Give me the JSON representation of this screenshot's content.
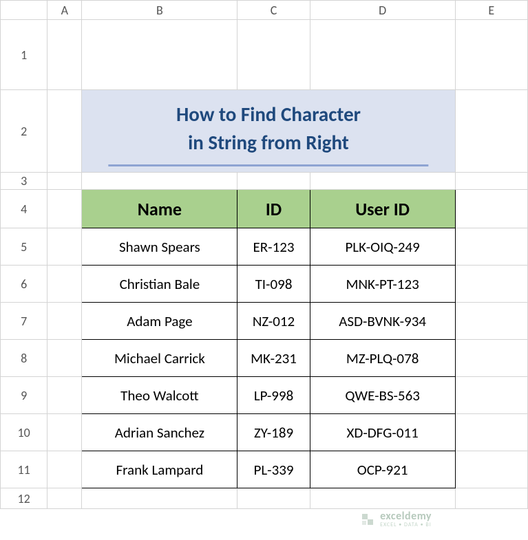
{
  "columns": [
    "A",
    "B",
    "C",
    "D",
    "E"
  ],
  "rows": [
    "1",
    "2",
    "3",
    "4",
    "5",
    "6",
    "7",
    "8",
    "9",
    "10",
    "11",
    "12"
  ],
  "title": {
    "line1": "How to Find Character",
    "line2": "in String from Right"
  },
  "table": {
    "headers": {
      "name": "Name",
      "id": "ID",
      "user_id": "User ID"
    },
    "rows": [
      {
        "name": "Shawn Spears",
        "id": "ER-123",
        "user_id": "PLK-OIQ-249"
      },
      {
        "name": "Christian Bale",
        "id": "TI-098",
        "user_id": "MNK-PT-123"
      },
      {
        "name": "Adam Page",
        "id": "NZ-012",
        "user_id": "ASD-BVNK-934"
      },
      {
        "name": "Michael Carrick",
        "id": "MK-231",
        "user_id": "MZ-PLQ-078"
      },
      {
        "name": "Theo Walcott",
        "id": "LP-998",
        "user_id": "QWE-BS-563"
      },
      {
        "name": "Adrian Sanchez",
        "id": "ZY-189",
        "user_id": "XD-DFG-011"
      },
      {
        "name": "Frank Lampard",
        "id": "PL-339",
        "user_id": "OCP-921"
      }
    ]
  },
  "watermark": {
    "brand": "exceldemy",
    "sub": "EXCEL • DATA • BI"
  }
}
